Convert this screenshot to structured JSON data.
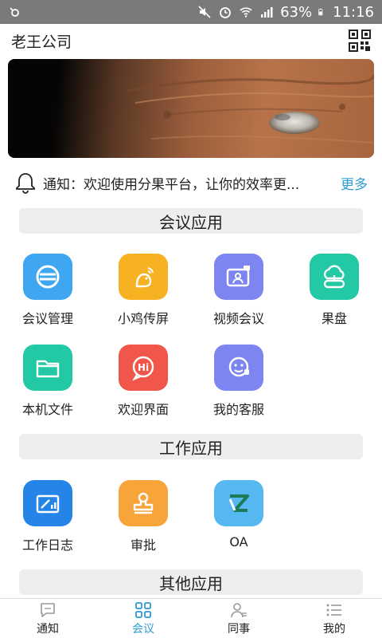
{
  "status_bar": {
    "battery": "63%",
    "time": "11:16"
  },
  "app_bar": {
    "title": "老王公司"
  },
  "notice": {
    "text": "通知：欢迎使用分果平台，让你的效率更...",
    "more": "更多"
  },
  "sections": [
    {
      "title": "会议应用",
      "apps": [
        {
          "label": "会议管理",
          "icon": "meeting-manage-icon",
          "color": "#3fa7f2"
        },
        {
          "label": "小鸡传屏",
          "icon": "chick-cast-icon",
          "color": "#f7b223"
        },
        {
          "label": "视频会议",
          "icon": "video-meeting-icon",
          "color": "#7d86f0"
        },
        {
          "label": "果盘",
          "icon": "cloud-disk-icon",
          "color": "#22c9a4"
        },
        {
          "label": "本机文件",
          "icon": "folder-icon",
          "color": "#22c9a4"
        },
        {
          "label": "欢迎界面",
          "icon": "welcome-hi-icon",
          "color": "#f0574a"
        },
        {
          "label": "我的客服",
          "icon": "customer-service-icon",
          "color": "#7d86f0"
        }
      ]
    },
    {
      "title": "工作应用",
      "apps": [
        {
          "label": "工作日志",
          "icon": "work-log-icon",
          "color": "#2584e8"
        },
        {
          "label": "审批",
          "icon": "approval-stamp-icon",
          "color": "#f7a53b"
        },
        {
          "label": "OA",
          "icon": "oa-icon",
          "color": "#56b8f0"
        }
      ]
    },
    {
      "title": "其他应用",
      "apps": []
    }
  ],
  "tab_bar": [
    {
      "label": "通知",
      "icon": "chat-bubble-icon",
      "active": false
    },
    {
      "label": "会议",
      "icon": "grid-icon",
      "active": true
    },
    {
      "label": "同事",
      "icon": "contacts-icon",
      "active": false
    },
    {
      "label": "我的",
      "icon": "list-icon",
      "active": false
    }
  ],
  "colors": {
    "accent": "#2e9bd6",
    "status_bar": "#7a7a7a",
    "section_bg": "#eeeeee"
  }
}
